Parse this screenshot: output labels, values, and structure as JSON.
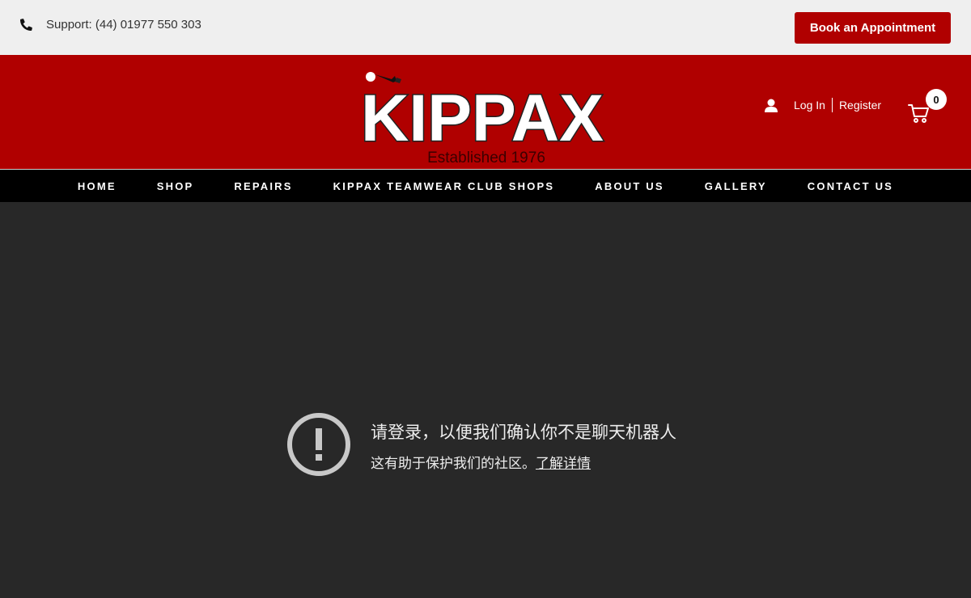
{
  "topbar": {
    "support_text": "Support: (44) 01977 550 303",
    "book_label": "Book an Appointment"
  },
  "header": {
    "logo_text": "KIPPAX",
    "logo_tagline": "Established 1976",
    "login_label": "Log In",
    "register_label": "Register",
    "cart_count": "0"
  },
  "nav": {
    "items": [
      "HOME",
      "SHOP",
      "REPAIRS",
      "KIPPAX TEAMWEAR CLUB SHOPS",
      "ABOUT US",
      "GALLERY",
      "CONTACT US"
    ]
  },
  "notice": {
    "title": "请登录，以便我们确认你不是聊天机器人",
    "subtitle": "这有助于保护我们的社区。",
    "link": "了解详情"
  },
  "colors": {
    "brand_red": "#b00000",
    "topbar_bg": "#efefef",
    "nav_bg": "#000000",
    "content_bg": "#282828",
    "warn_icon": "#c8c8c8"
  },
  "icons": [
    "phone-icon",
    "user-icon",
    "cart-icon",
    "exclamation-circle-icon"
  ]
}
